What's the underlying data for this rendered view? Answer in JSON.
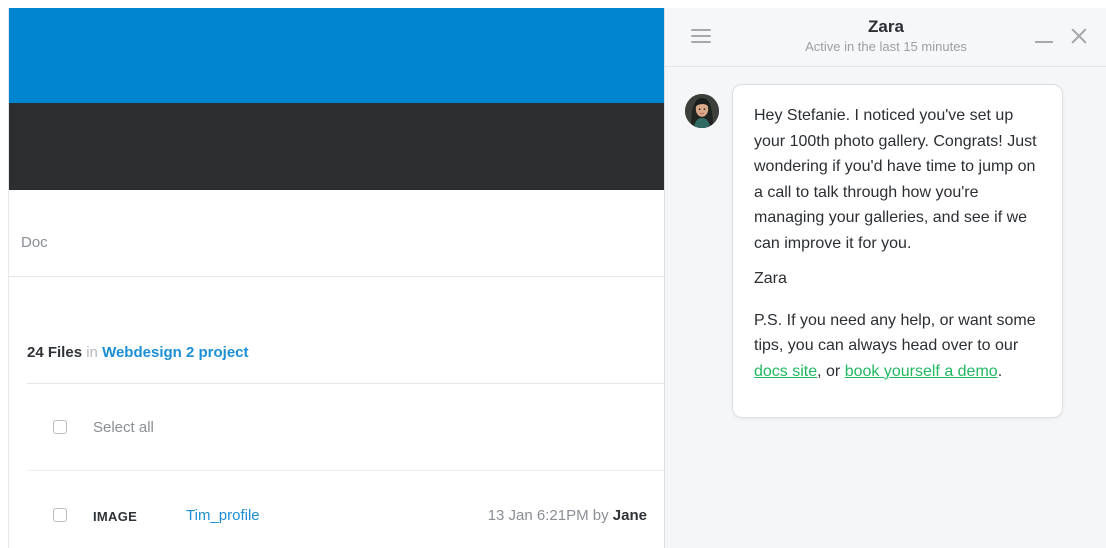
{
  "app": {
    "doc_label": "Doc",
    "files": {
      "count": "24 Files",
      "in": "in",
      "project": "Webdesign 2 project"
    },
    "select_all": "Select all",
    "rows": [
      {
        "type": "IMAGE",
        "name": "Tim_profile",
        "date": "13 Jan 6:21PM by",
        "by": "Jane"
      }
    ],
    "colors": {
      "header_blue": "#0185d0",
      "header_dark": "#2b2d2f",
      "link_blue": "#1b8fd6"
    }
  },
  "chat": {
    "agent_name": "Zara",
    "agent_status": "Active in the last 15 minutes",
    "icons": {
      "menu": "hamburger-icon",
      "minimize": "minimize-icon",
      "close": "close-icon"
    },
    "message": {
      "body": "Hey Stefanie. I noticed you've set up your 100th photo gallery. Congrats! Just wondering if you'd have time to jump on a call to talk through how you're managing your galleries, and see if we can improve it for you.",
      "signature": "Zara",
      "ps_before": "P.S. If you need any help, or want some tips, you can always head over to our ",
      "link_docs": "docs site",
      "ps_middle": ", or ",
      "link_demo": "book yourself a demo",
      "ps_end": "."
    },
    "colors": {
      "link_green": "#21b861"
    }
  }
}
